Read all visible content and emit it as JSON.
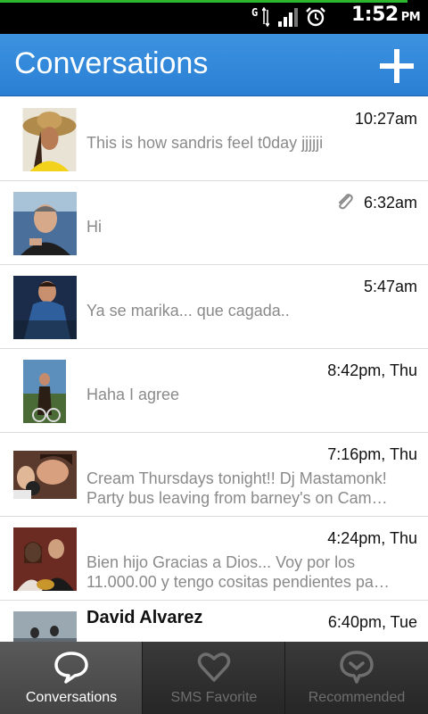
{
  "status_bar": {
    "time": "1:52",
    "ampm": "PM",
    "network_label": "G",
    "icons": [
      "network-type-icon",
      "signal-bars-icon",
      "alarm-icon"
    ]
  },
  "header": {
    "title": "Conversations",
    "add_icon": "plus-icon",
    "color": "#2f86d8"
  },
  "conversations": [
    {
      "name": "",
      "time": "10:27am",
      "lines": [
        "This is how sandris feel t0day jjjjji"
      ],
      "attachment": false
    },
    {
      "name": "",
      "time": "6:32am",
      "lines": [
        "Hi"
      ],
      "attachment": true
    },
    {
      "name": "",
      "time": "5:47am",
      "lines": [
        "Ya se marika... que cagada.."
      ],
      "attachment": false
    },
    {
      "name": "",
      "time": "8:42pm, Thu",
      "lines": [
        "Haha I agree"
      ],
      "attachment": false
    },
    {
      "name": "",
      "time": "7:16pm, Thu",
      "lines": [
        "Cream Thursdays tonight!! Dj Mastamonk!",
        "Party bus leaving from barney's on Cam…"
      ],
      "attachment": false
    },
    {
      "name": "",
      "time": "4:24pm, Thu",
      "lines": [
        "Bien hijo Gracias a Dios... Voy por los",
        "11.000.00 y tengo cositas pendientes pa…"
      ],
      "attachment": false
    },
    {
      "name": "David Alvarez",
      "time": "6:40pm, Tue",
      "lines": [
        ""
      ],
      "attachment": false
    }
  ],
  "tabs": [
    {
      "label": "Conversations",
      "icon": "speech-bubble-icon",
      "active": true
    },
    {
      "label": "SMS Favorite",
      "icon": "heart-icon",
      "active": false
    },
    {
      "label": "Recommended",
      "icon": "recommend-bubble-icon",
      "active": false
    }
  ]
}
